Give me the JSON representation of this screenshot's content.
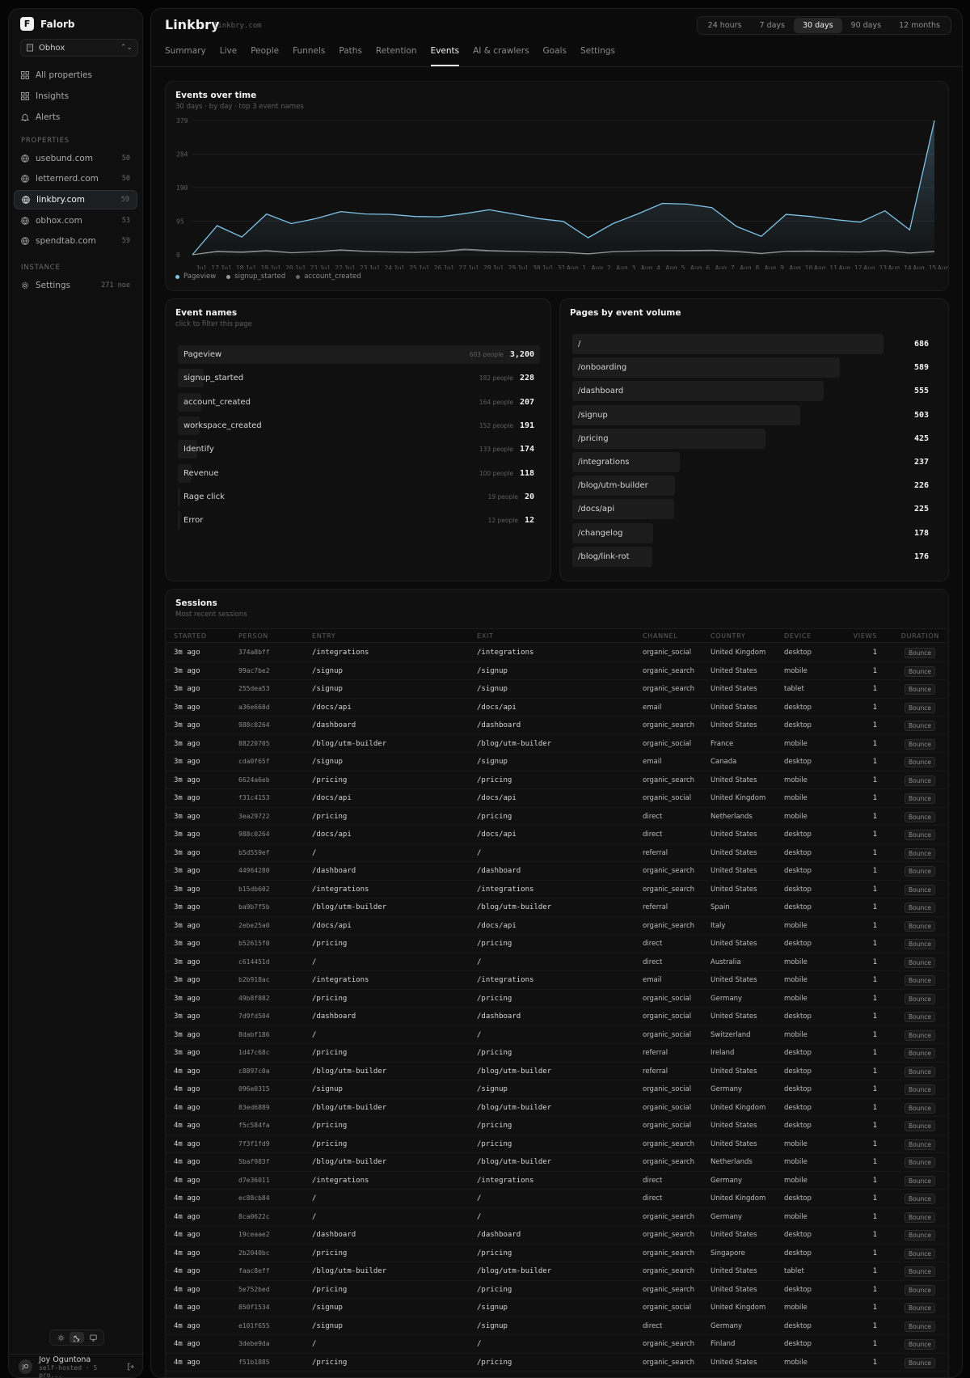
{
  "app": {
    "brand_initial": "F",
    "brand_name": "Falorb",
    "org": "Obhox"
  },
  "sidebar": {
    "nav": [
      {
        "label": "All properties",
        "icon": "grid-icon"
      },
      {
        "label": "Insights",
        "icon": "grid-icon"
      },
      {
        "label": "Alerts",
        "icon": "bell-icon"
      }
    ],
    "properties_label": "PROPERTIES",
    "properties": [
      {
        "label": "usebund.com",
        "count": "50"
      },
      {
        "label": "letternerd.com",
        "count": "50"
      },
      {
        "label": "linkbry.com",
        "count": "59",
        "active": true
      },
      {
        "label": "obhox.com",
        "count": "53"
      },
      {
        "label": "spendtab.com",
        "count": "59"
      }
    ],
    "instance_label": "INSTANCE",
    "settings": {
      "label": "Settings",
      "count": "271 noe"
    },
    "user": {
      "initials": "JO",
      "name": "Joy Oguntona",
      "sub": "self-hosted · 5 pro..."
    }
  },
  "header": {
    "title": "Linkbry",
    "domain": "linkbry.com",
    "ranges": [
      "24 hours",
      "7 days",
      "30 days",
      "90 days",
      "12 months"
    ],
    "active_range": 2,
    "tabs": [
      "Summary",
      "Live",
      "People",
      "Funnels",
      "Paths",
      "Retention",
      "Events",
      "AI & crawlers",
      "Goals",
      "Settings"
    ],
    "active_tab": 6
  },
  "events_card": {
    "title": "Events over time",
    "subtitle": "30 days · by day · top 3 event names"
  },
  "chart_data": {
    "type": "area",
    "yticks": [
      0,
      95,
      190,
      284,
      379
    ],
    "ylim": [
      0,
      379
    ],
    "grid": true,
    "legend_position": "bottom-left",
    "x": [
      "Jul 17",
      "Jul 18",
      "Jul 19",
      "Jul 20",
      "Jul 21",
      "Jul 22",
      "Jul 23",
      "Jul 24",
      "Jul 25",
      "Jul 26",
      "Jul 27",
      "Jul 28",
      "Jul 29",
      "Jul 30",
      "Jul 31",
      "Aug 1",
      "Aug 2",
      "Aug 3",
      "Aug 4",
      "Aug 5",
      "Aug 6",
      "Aug 7",
      "Aug 8",
      "Aug 9",
      "Aug 10",
      "Aug 11",
      "Aug 12",
      "Aug 13",
      "Aug 14",
      "Aug 15",
      "Aug 16"
    ],
    "series": [
      {
        "name": "Pageview",
        "color": "#7ec3e8",
        "values": [
          0,
          82,
          50,
          115,
          88,
          102,
          122,
          115,
          114,
          108,
          107,
          116,
          127,
          115,
          102,
          94,
          48,
          88,
          115,
          145,
          143,
          133,
          80,
          52,
          114,
          108,
          99,
          92,
          124,
          70,
          379
        ]
      },
      {
        "name": "signup_started",
        "color": "#9a9a9a",
        "values": [
          0,
          10,
          8,
          12,
          6,
          9,
          14,
          10,
          8,
          7,
          9,
          16,
          12,
          10,
          8,
          7,
          3,
          9,
          11,
          12,
          12,
          13,
          10,
          4,
          10,
          11,
          9,
          8,
          12,
          5,
          10
        ]
      },
      {
        "name": "account_created",
        "color": "#6a6a6a",
        "values": [
          0,
          8,
          6,
          10,
          5,
          8,
          12,
          9,
          7,
          6,
          8,
          13,
          10,
          9,
          7,
          6,
          2,
          8,
          10,
          11,
          10,
          11,
          8,
          3,
          9,
          9,
          8,
          7,
          10,
          4,
          8
        ]
      }
    ]
  },
  "event_names": {
    "title": "Event names",
    "subtitle": "click to filter this page",
    "rows": [
      {
        "name": "Pageview",
        "people": "603 people",
        "count": "3,200",
        "share": 1.0
      },
      {
        "name": "signup_started",
        "people": "182 people",
        "count": "228",
        "share": 0.071
      },
      {
        "name": "account_created",
        "people": "164 people",
        "count": "207",
        "share": 0.065
      },
      {
        "name": "workspace_created",
        "people": "152 people",
        "count": "191",
        "share": 0.06
      },
      {
        "name": "Identify",
        "people": "133 people",
        "count": "174",
        "share": 0.054
      },
      {
        "name": "Revenue",
        "people": "100 people",
        "count": "118",
        "share": 0.037
      },
      {
        "name": "Rage click",
        "people": "19 people",
        "count": "20",
        "share": 0.006
      },
      {
        "name": "Error",
        "people": "12 people",
        "count": "12",
        "share": 0.004
      }
    ]
  },
  "pages": {
    "title": "Pages by event volume",
    "rows": [
      {
        "path": "/",
        "count": "686",
        "share": 1.0
      },
      {
        "path": "/onboarding",
        "count": "589",
        "share": 0.859
      },
      {
        "path": "/dashboard",
        "count": "555",
        "share": 0.809
      },
      {
        "path": "/signup",
        "count": "503",
        "share": 0.733
      },
      {
        "path": "/pricing",
        "count": "425",
        "share": 0.62
      },
      {
        "path": "/integrations",
        "count": "237",
        "share": 0.345
      },
      {
        "path": "/blog/utm-builder",
        "count": "226",
        "share": 0.329
      },
      {
        "path": "/docs/api",
        "count": "225",
        "share": 0.328
      },
      {
        "path": "/changelog",
        "count": "178",
        "share": 0.259
      },
      {
        "path": "/blog/link-rot",
        "count": "176",
        "share": 0.257
      }
    ]
  },
  "sessions": {
    "title": "Sessions",
    "subtitle": "Most recent sessions",
    "columns": [
      "STARTED",
      "PERSON",
      "ENTRY",
      "EXIT",
      "CHANNEL",
      "COUNTRY",
      "DEVICE",
      "VIEWS",
      "DURATION"
    ],
    "rows": [
      [
        "3m ago",
        "374a8bff",
        "/integrations",
        "/integrations",
        "organic_social",
        "United Kingdom",
        "desktop",
        "1",
        "Bounce"
      ],
      [
        "3m ago",
        "99ac7be2",
        "/signup",
        "/signup",
        "organic_search",
        "United States",
        "mobile",
        "1",
        "Bounce"
      ],
      [
        "3m ago",
        "255dea53",
        "/signup",
        "/signup",
        "organic_search",
        "United States",
        "tablet",
        "1",
        "Bounce"
      ],
      [
        "3m ago",
        "a36e668d",
        "/docs/api",
        "/docs/api",
        "email",
        "United States",
        "desktop",
        "1",
        "Bounce"
      ],
      [
        "3m ago",
        "988c0264",
        "/dashboard",
        "/dashboard",
        "organic_search",
        "United States",
        "desktop",
        "1",
        "Bounce"
      ],
      [
        "3m ago",
        "88220705",
        "/blog/utm-builder",
        "/blog/utm-builder",
        "organic_social",
        "France",
        "mobile",
        "1",
        "Bounce"
      ],
      [
        "3m ago",
        "cda0f65f",
        "/signup",
        "/signup",
        "email",
        "Canada",
        "desktop",
        "1",
        "Bounce"
      ],
      [
        "3m ago",
        "6624a6eb",
        "/pricing",
        "/pricing",
        "organic_search",
        "United States",
        "mobile",
        "1",
        "Bounce"
      ],
      [
        "3m ago",
        "f31c4153",
        "/docs/api",
        "/docs/api",
        "organic_social",
        "United Kingdom",
        "mobile",
        "1",
        "Bounce"
      ],
      [
        "3m ago",
        "3ea29722",
        "/pricing",
        "/pricing",
        "direct",
        "Netherlands",
        "mobile",
        "1",
        "Bounce"
      ],
      [
        "3m ago",
        "988c0264",
        "/docs/api",
        "/docs/api",
        "direct",
        "United States",
        "desktop",
        "1",
        "Bounce"
      ],
      [
        "3m ago",
        "b5d559ef",
        "/",
        "/",
        "referral",
        "United States",
        "desktop",
        "1",
        "Bounce"
      ],
      [
        "3m ago",
        "44964280",
        "/dashboard",
        "/dashboard",
        "organic_search",
        "United States",
        "desktop",
        "1",
        "Bounce"
      ],
      [
        "3m ago",
        "b15db602",
        "/integrations",
        "/integrations",
        "organic_search",
        "United States",
        "desktop",
        "1",
        "Bounce"
      ],
      [
        "3m ago",
        "ba9b7f5b",
        "/blog/utm-builder",
        "/blog/utm-builder",
        "referral",
        "Spain",
        "desktop",
        "1",
        "Bounce"
      ],
      [
        "3m ago",
        "2ebe25a0",
        "/docs/api",
        "/docs/api",
        "organic_search",
        "Italy",
        "mobile",
        "1",
        "Bounce"
      ],
      [
        "3m ago",
        "b52615f0",
        "/pricing",
        "/pricing",
        "direct",
        "United States",
        "desktop",
        "1",
        "Bounce"
      ],
      [
        "3m ago",
        "c614451d",
        "/",
        "/",
        "direct",
        "Australia",
        "mobile",
        "1",
        "Bounce"
      ],
      [
        "3m ago",
        "b2b918ac",
        "/integrations",
        "/integrations",
        "email",
        "United States",
        "mobile",
        "1",
        "Bounce"
      ],
      [
        "3m ago",
        "49b8f882",
        "/pricing",
        "/pricing",
        "organic_social",
        "Germany",
        "mobile",
        "1",
        "Bounce"
      ],
      [
        "3m ago",
        "7d9fd504",
        "/dashboard",
        "/dashboard",
        "organic_social",
        "United States",
        "desktop",
        "1",
        "Bounce"
      ],
      [
        "3m ago",
        "8dabf186",
        "/",
        "/",
        "organic_social",
        "Switzerland",
        "mobile",
        "1",
        "Bounce"
      ],
      [
        "3m ago",
        "1d47c68c",
        "/pricing",
        "/pricing",
        "referral",
        "Ireland",
        "desktop",
        "1",
        "Bounce"
      ],
      [
        "4m ago",
        "c8897c0a",
        "/blog/utm-builder",
        "/blog/utm-builder",
        "referral",
        "United States",
        "desktop",
        "1",
        "Bounce"
      ],
      [
        "4m ago",
        "096e0315",
        "/signup",
        "/signup",
        "organic_social",
        "Germany",
        "desktop",
        "1",
        "Bounce"
      ],
      [
        "4m ago",
        "83ed6889",
        "/blog/utm-builder",
        "/blog/utm-builder",
        "organic_social",
        "United Kingdom",
        "desktop",
        "1",
        "Bounce"
      ],
      [
        "4m ago",
        "f5c584fa",
        "/pricing",
        "/pricing",
        "organic_social",
        "United States",
        "desktop",
        "1",
        "Bounce"
      ],
      [
        "4m ago",
        "7f3f1fd9",
        "/pricing",
        "/pricing",
        "organic_search",
        "United States",
        "mobile",
        "1",
        "Bounce"
      ],
      [
        "4m ago",
        "5baf983f",
        "/blog/utm-builder",
        "/blog/utm-builder",
        "organic_search",
        "Netherlands",
        "mobile",
        "1",
        "Bounce"
      ],
      [
        "4m ago",
        "d7e36011",
        "/integrations",
        "/integrations",
        "direct",
        "Germany",
        "mobile",
        "1",
        "Bounce"
      ],
      [
        "4m ago",
        "ec88cb84",
        "/",
        "/",
        "direct",
        "United Kingdom",
        "desktop",
        "1",
        "Bounce"
      ],
      [
        "4m ago",
        "8ca0622c",
        "/",
        "/",
        "organic_search",
        "Germany",
        "mobile",
        "1",
        "Bounce"
      ],
      [
        "4m ago",
        "19ceaae2",
        "/dashboard",
        "/dashboard",
        "organic_search",
        "United States",
        "desktop",
        "1",
        "Bounce"
      ],
      [
        "4m ago",
        "2b2040bc",
        "/pricing",
        "/pricing",
        "organic_search",
        "Singapore",
        "desktop",
        "1",
        "Bounce"
      ],
      [
        "4m ago",
        "faac8eff",
        "/blog/utm-builder",
        "/blog/utm-builder",
        "organic_search",
        "United States",
        "tablet",
        "1",
        "Bounce"
      ],
      [
        "4m ago",
        "5e752bed",
        "/pricing",
        "/pricing",
        "organic_search",
        "United States",
        "desktop",
        "1",
        "Bounce"
      ],
      [
        "4m ago",
        "850f1534",
        "/signup",
        "/signup",
        "organic_social",
        "United Kingdom",
        "mobile",
        "1",
        "Bounce"
      ],
      [
        "4m ago",
        "e101f655",
        "/signup",
        "/signup",
        "direct",
        "Germany",
        "desktop",
        "1",
        "Bounce"
      ],
      [
        "4m ago",
        "3debe9da",
        "/",
        "/",
        "organic_search",
        "Finland",
        "desktop",
        "1",
        "Bounce"
      ],
      [
        "4m ago",
        "f51b1885",
        "/pricing",
        "/pricing",
        "organic_search",
        "United States",
        "mobile",
        "1",
        "Bounce"
      ]
    ]
  }
}
